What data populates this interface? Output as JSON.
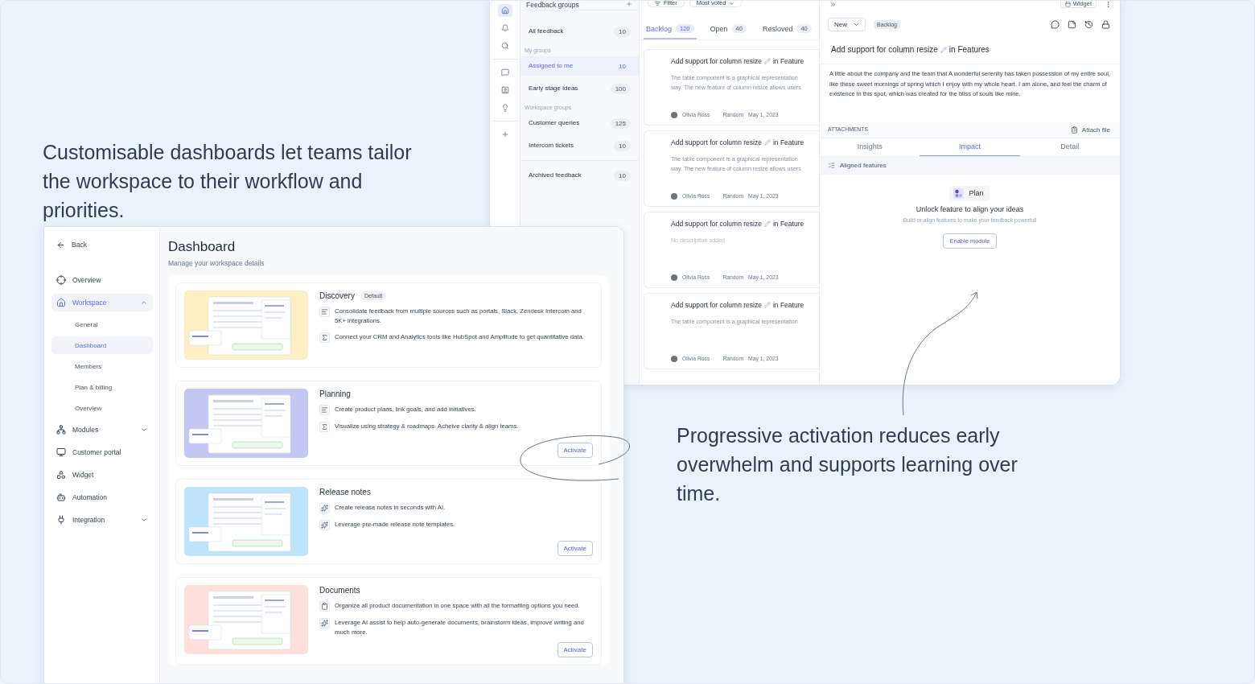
{
  "captions": {
    "left": "Customisable dashboards let teams tailor the workspace to their workflow and priorities.",
    "right": "Progressive activation reduces early overwhelm and supports learning over time."
  },
  "feedback_app": {
    "groups": {
      "title": "Feedback groups",
      "items": [
        {
          "kind": "item",
          "label": "All feedback",
          "count": "10",
          "selected": false
        },
        {
          "kind": "section",
          "label": "My groups"
        },
        {
          "kind": "item",
          "label": "Assigned to me",
          "count": "10",
          "selected": true
        },
        {
          "kind": "item",
          "label": "Early stage ideas",
          "count": "100",
          "selected": false
        },
        {
          "kind": "section",
          "label": "Workspace groups"
        },
        {
          "kind": "item",
          "label": "Customer queries",
          "count": "125",
          "selected": false
        },
        {
          "kind": "item",
          "label": "Intercom tickets",
          "count": "10",
          "selected": false
        },
        {
          "kind": "divider"
        },
        {
          "kind": "item",
          "label": "Archived feedback",
          "count": "10",
          "selected": false
        }
      ]
    },
    "toolbar": {
      "filter": "Filter",
      "sort": "Most voted"
    },
    "tabs": [
      {
        "label": "Backlog",
        "count": "120",
        "selected": true
      },
      {
        "label": "Open",
        "count": "40",
        "selected": false
      },
      {
        "label": "Resloved",
        "count": "40",
        "selected": false
      }
    ],
    "cards": [
      {
        "title": "Add support for column resize",
        "title_end": "in Feature",
        "description": [
          "The table component is a graphical representation",
          "way. The new feature of column resize allows users"
        ],
        "empty": false,
        "author": "Olivia Ross",
        "tag": "Random",
        "date": "May 1, 2023"
      },
      {
        "title": "Add support for column resize",
        "title_end": "in Feature",
        "description": [
          "The table component is a graphical representation",
          "way. The new feature of column resize allows users"
        ],
        "empty": false,
        "author": "Olivia Ross",
        "tag": "Random",
        "date": "May 1, 2023"
      },
      {
        "title": "Add support for column resize",
        "title_end": "in Feature",
        "description": [
          "No description added"
        ],
        "empty": true,
        "author": "Olivia Ross",
        "tag": "Random",
        "date": "May 1, 2023"
      },
      {
        "title": "Add support for column resize",
        "title_end": "in Feature",
        "description": [
          "The table component is a graphical representation"
        ],
        "empty": false,
        "author": "Olivia Ross",
        "tag": "Random",
        "date": "May 1, 2023"
      }
    ],
    "detail": {
      "widget": "Widget",
      "status": "New",
      "badge": "Backlog",
      "title": "Add support for column resize",
      "title_end": "in Features",
      "description": "A little about the company and the team that A wonderful serenity has taken possession of my entire soul, like these sweet mornings of spring which I enjoy with my whole heart. I am alone, and feel the charm of existence in this spot, which was created for the bliss of souls like mine.",
      "attachments": "ATTACHMENTS",
      "attach": "Attach file",
      "tabs": [
        {
          "label": "Insights",
          "selected": false
        },
        {
          "label": "Impact",
          "selected": true
        },
        {
          "label": "Detail",
          "selected": false
        }
      ],
      "section": "Aligned features",
      "chip": "Plan",
      "heading": "Unlock feature to align your ideas",
      "subtext": "Build or align features to make your feedback powerfull",
      "button": "Enable module"
    }
  },
  "dashboard": {
    "sidebar": {
      "back": "Back",
      "items": [
        {
          "label": "Overview",
          "kind": "overview"
        },
        {
          "label": "Workspace",
          "kind": "workspace",
          "selected": true,
          "expanded": true,
          "children": [
            {
              "label": "General",
              "selected": false
            },
            {
              "label": "Dashboard",
              "selected": true
            },
            {
              "label": "Members",
              "selected": false
            },
            {
              "label": "Plan & billing",
              "selected": false
            },
            {
              "label": "Overview",
              "selected": false
            }
          ]
        },
        {
          "label": "Modules",
          "kind": "modules",
          "expanded": false
        },
        {
          "label": "Customer portal",
          "kind": "portal"
        },
        {
          "label": "Widget",
          "kind": "widget"
        },
        {
          "label": "Automation",
          "kind": "automation"
        },
        {
          "label": "Integration",
          "kind": "integration",
          "expanded": false
        }
      ]
    },
    "title": "Dashboard",
    "subtitle": "Manage your workspace details",
    "modules": [
      {
        "name": "Discovery",
        "badge": "Default",
        "color": "#fdeec3",
        "features": [
          {
            "kind": "list",
            "text": "Consolidate feedback from multiple sources such as portals, Slack, Zendesk Intercom and 5K+ integrations."
          },
          {
            "kind": "sigma",
            "text": "Connect your CRM and Analytics tools like HubSpot and Amplitude to get quantitative data."
          }
        ]
      },
      {
        "name": "Planning",
        "color": "#c3c8f3",
        "action": "Activate",
        "features": [
          {
            "kind": "list",
            "text": "Create product plans, link goals, and add initiatives."
          },
          {
            "kind": "sigma",
            "text": "Visualize using strategy & roadmaps. Acheive clarity & align teams."
          }
        ]
      },
      {
        "name": "Release notes",
        "color": "#bfe3fb",
        "action": "Activate",
        "features": [
          {
            "kind": "sparkle",
            "text": "Create release notes in seconds with AI."
          },
          {
            "kind": "sparkle",
            "text": "Leverage pre-made release note templates."
          }
        ]
      },
      {
        "name": "Documents",
        "color": "#fde0dc",
        "action": "Activate",
        "features": [
          {
            "kind": "clipboard",
            "text": "Organize all product documentation in one space with all the formatting options you need."
          },
          {
            "kind": "sparkle",
            "text": "Leverage AI assist to help auto-generate documents, brainstorm ideas, improve writing and much more."
          }
        ]
      }
    ]
  }
}
